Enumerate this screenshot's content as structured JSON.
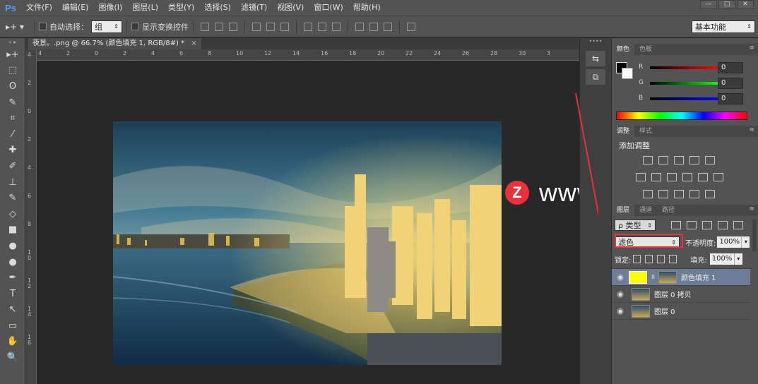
{
  "app": {
    "logo": "Ps"
  },
  "menu": [
    "文件(F)",
    "编辑(E)",
    "图像(I)",
    "图层(L)",
    "类型(Y)",
    "选择(S)",
    "滤镜(T)",
    "视图(V)",
    "窗口(W)",
    "帮助(H)"
  ],
  "window_controls": [
    "—",
    "□",
    "✕"
  ],
  "options": {
    "auto_select_label": "自动选择：",
    "auto_select_value": "组",
    "show_transform_label": "显示变换控件",
    "workspace": "基本功能"
  },
  "document": {
    "tab_title": "夜景。.png @ 66.7% (颜色填充 1, RGB/8#) *",
    "close": "×"
  },
  "rulers": {
    "top_ticks": [
      "4",
      "2",
      "0",
      "2",
      "4",
      "6",
      "8",
      "10",
      "12",
      "14",
      "16",
      "18",
      "20",
      "22",
      "24",
      "26",
      "28",
      "30",
      "3"
    ],
    "left_ticks": [
      "4",
      "2",
      "0",
      "2",
      "4",
      "6",
      "8",
      "1\n0",
      "1\n2",
      "1\n4",
      "1\n6"
    ]
  },
  "tools": [
    "move-tool",
    "marquee-tool",
    "lasso-tool",
    "quick-select-tool",
    "crop-tool",
    "eyedropper-tool",
    "healing-tool",
    "brush-tool",
    "stamp-tool",
    "history-brush-tool",
    "eraser-tool",
    "gradient-tool",
    "blur-tool",
    "dodge-tool",
    "pen-tool",
    "type-tool",
    "path-select-tool",
    "shape-tool",
    "hand-tool",
    "zoom-tool"
  ],
  "tool_glyphs": [
    "▸+",
    "⬚",
    "ʘ",
    "✎",
    "⌗",
    "⁄",
    "✚",
    "✐",
    "⊥",
    "✎",
    "◇",
    "■",
    "●",
    "●",
    "✒",
    "T",
    "↖",
    "▭",
    "✋",
    "🔍"
  ],
  "panels": {
    "color": {
      "tabs": [
        "颜色",
        "色板"
      ],
      "rows": [
        {
          "label": "R",
          "value": "0"
        },
        {
          "label": "G",
          "value": "0"
        },
        {
          "label": "B",
          "value": "0"
        }
      ]
    },
    "adjustments": {
      "tabs": [
        "调整",
        "样式"
      ],
      "title": "添加调整"
    },
    "layers": {
      "tabs": [
        "图层",
        "通道",
        "路径"
      ],
      "filter_kind": "ρ 类型",
      "blend_mode": "滤色",
      "opacity_label": "不透明度:",
      "opacity_value": "100%",
      "lock_label": "锁定:",
      "fill_label": "填充:",
      "fill_value": "100%",
      "items": [
        {
          "name": "颜色填充 1",
          "selected": true
        },
        {
          "name": "图层 0 拷贝",
          "selected": false
        },
        {
          "name": "图层 0",
          "selected": false
        }
      ]
    }
  },
  "watermark": {
    "badge": "Z",
    "text": "www.MacZ.com"
  },
  "colors": {
    "accent": "#e8313b",
    "panel": "#535353",
    "canvas": "#282828",
    "fill_swatch": "#ffff00"
  }
}
